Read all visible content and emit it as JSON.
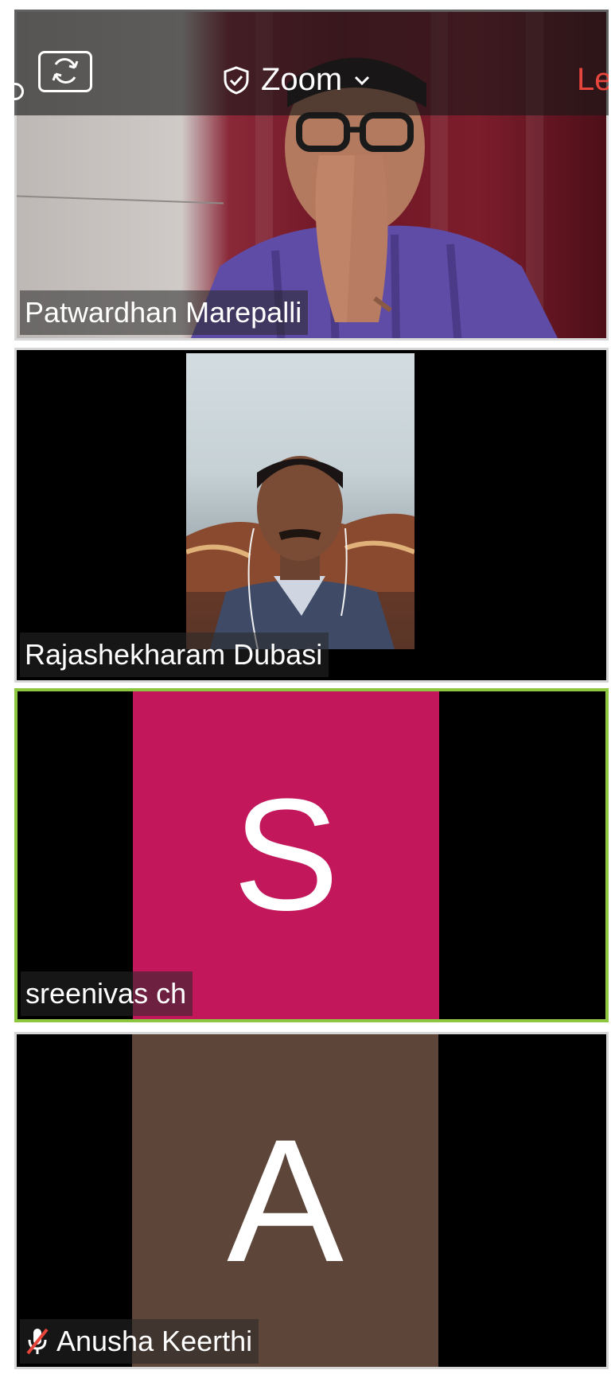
{
  "app": {
    "title": "Zoom",
    "leave_label": "Le",
    "security_icon": "shield-check-icon",
    "camera_switch_icon": "camera-switch-icon",
    "dropdown_icon": "chevron-down-icon"
  },
  "participants": [
    {
      "name": "Patwardhan Marepalli",
      "video": true,
      "active_speaker": false
    },
    {
      "name": "Rajashekharam Dubasi",
      "video": true,
      "active_speaker": false
    },
    {
      "name": "sreenivas ch",
      "video": false,
      "initial": "S",
      "avatar_color": "#c2185b",
      "active_speaker": true
    },
    {
      "name": "Anusha Keerthi",
      "video": false,
      "initial": "A",
      "avatar_color": "#5d4539",
      "muted": true,
      "active_speaker": false
    }
  ],
  "colors": {
    "active_speaker_border": "#8dc63f",
    "leave": "#e8453c",
    "tile_border": "#d7d7d7"
  }
}
